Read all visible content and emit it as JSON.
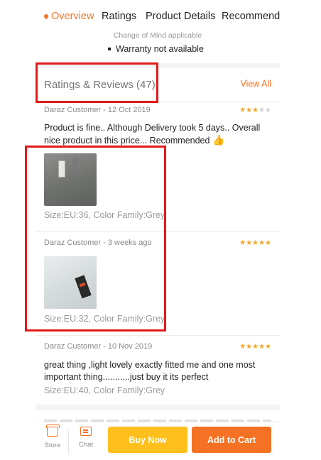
{
  "tabs": [
    {
      "label": "Overview",
      "active": true
    },
    {
      "label": "Ratings",
      "active": false
    },
    {
      "label": "Product Details",
      "active": false
    },
    {
      "label": "Recommendations",
      "active": false
    }
  ],
  "return_policy": {
    "change_of_mind": "Change of Mind applicable",
    "warranty": "Warranty not available"
  },
  "reviews_section": {
    "title": "Ratings & Reviews (47)",
    "view_all": "View All",
    "reviews": [
      {
        "meta": "Daraz Customer - 12 Oct 2019",
        "rating": 3,
        "text": "Product is fine.. Although Delivery took 5 days.. Overall nice product in this price... Recommended",
        "emoji": "👍",
        "photo": "grey-trousers-photo",
        "sku": "Size:EU:36, Color Family:Grey"
      },
      {
        "meta": "Daraz Customer - 3  weeks ago",
        "rating": 5,
        "text": "",
        "photo": "light-grey-trousers-photo",
        "sku": "Size:EU:32, Color Family:Grey"
      },
      {
        "meta": "Daraz Customer - 10 Nov 2019",
        "rating": 5,
        "text": "great thing ,light lovely exactly fitted me   and one most important thing...........just buy it its perfect",
        "sku": "Size:EU:40, Color Family:Grey"
      }
    ]
  },
  "bottom_bar": {
    "store_label": "Store",
    "chat_label": "Chat",
    "buy_now": "Buy Now",
    "add_to_cart": "Add to Cart"
  },
  "colors": {
    "accent": "#f57224",
    "buy_now": "#ffc01d",
    "highlight": "#e11a1a",
    "star": "#f5a623"
  }
}
